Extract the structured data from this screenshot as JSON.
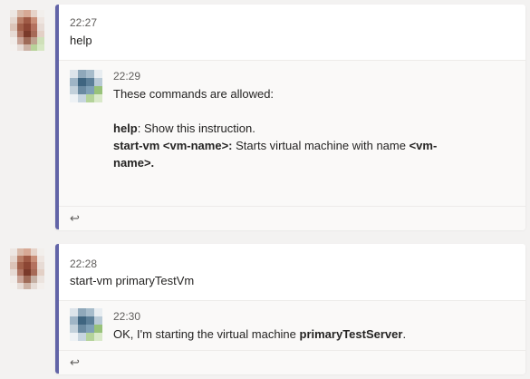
{
  "threads": [
    {
      "root": {
        "time": "22:27",
        "text": "help"
      },
      "reply": {
        "time": "22:29",
        "intro": "These commands are allowed:",
        "commands": [
          {
            "name": "help",
            "sep": ": ",
            "desc": "Show this instruction."
          },
          {
            "name": "start-vm <vm-name>:",
            "desc": " Starts virtual machine with name ",
            "arg_line1": "<vm-",
            "arg_line2": "name>."
          }
        ]
      },
      "reply_icon": "reply-arrow-icon"
    },
    {
      "root": {
        "time": "22:28",
        "text": "start-vm primaryTestVm"
      },
      "reply": {
        "time": "22:30",
        "text_prefix": "OK, I'm starting the virtual machine ",
        "vm_name": "primaryTestServer",
        "text_suffix": "."
      },
      "reply_icon": "reply-arrow-icon"
    }
  ],
  "colors": {
    "accent": "#6264a7",
    "background": "#f3f2f1",
    "card": "#ffffff",
    "reply_bg": "#faf9f8"
  }
}
